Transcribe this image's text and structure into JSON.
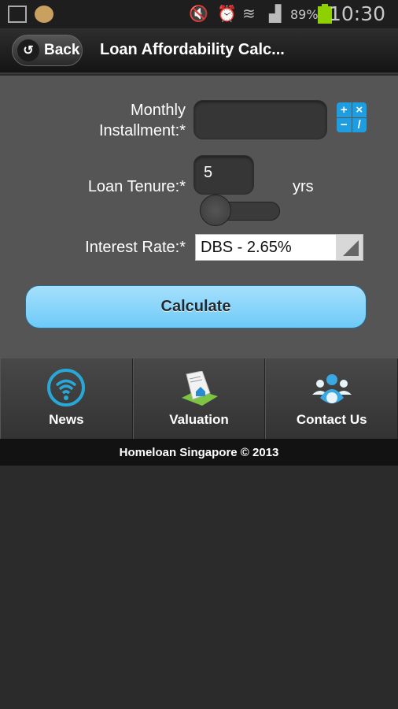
{
  "status_bar": {
    "battery": "89%",
    "time": "10:30",
    "battery_color": "#8ed000"
  },
  "header": {
    "back_label": "Back",
    "title": "Loan Affordability Calc..."
  },
  "form": {
    "monthly_label_1": "Monthly",
    "monthly_label_2": "Installment:*",
    "monthly_value": "",
    "tenure_label": "Loan Tenure:*",
    "tenure_value": "5",
    "tenure_unit": "yrs",
    "tenure_slider_fraction": 0,
    "rate_label": "Interest Rate:*",
    "rate_selected": "DBS - 2.65%",
    "calc_symbols": [
      "+",
      "×",
      "−",
      "/"
    ]
  },
  "calculate_label": "Calculate",
  "accent": "#6dcaf8",
  "nav": [
    {
      "label": "News",
      "icon": "news-wifi-icon"
    },
    {
      "label": "Valuation",
      "icon": "valuation-document-icon"
    },
    {
      "label": "Contact Us",
      "icon": "contact-people-icon"
    }
  ],
  "footer": "Homeloan Singapore © 2013"
}
